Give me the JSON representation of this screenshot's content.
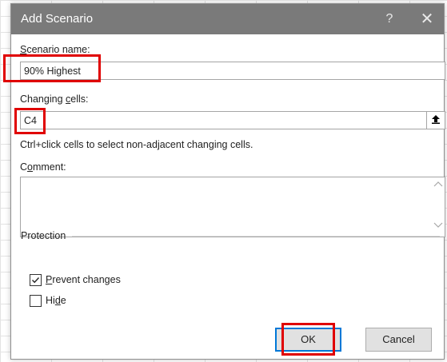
{
  "dialog": {
    "title": "Add Scenario",
    "help_glyph": "?",
    "close_glyph": "✕"
  },
  "scenario_name": {
    "label_pre": "",
    "label_key": "S",
    "label_post": "cenario name:",
    "value": "90% Highest"
  },
  "changing_cells": {
    "label_pre": "Changing ",
    "label_key": "c",
    "label_post": "ells:",
    "value": "C4",
    "collapse_glyph": "⭱"
  },
  "hint": "Ctrl+click cells to select non-adjacent changing cells.",
  "comment": {
    "label_pre": "C",
    "label_key": "o",
    "label_post": "mment:",
    "value": ""
  },
  "protection": {
    "label": "Protection",
    "prevent_changes": {
      "label_key": "P",
      "label_post": "revent changes",
      "checked": true
    },
    "hide": {
      "label_pre": "Hi",
      "label_key": "d",
      "label_post": "e",
      "checked": false
    }
  },
  "buttons": {
    "ok": "OK",
    "cancel": "Cancel"
  },
  "colors": {
    "titlebar": "#7a7a7a",
    "highlight": "#e00000",
    "ok_focus": "#0078d7"
  }
}
